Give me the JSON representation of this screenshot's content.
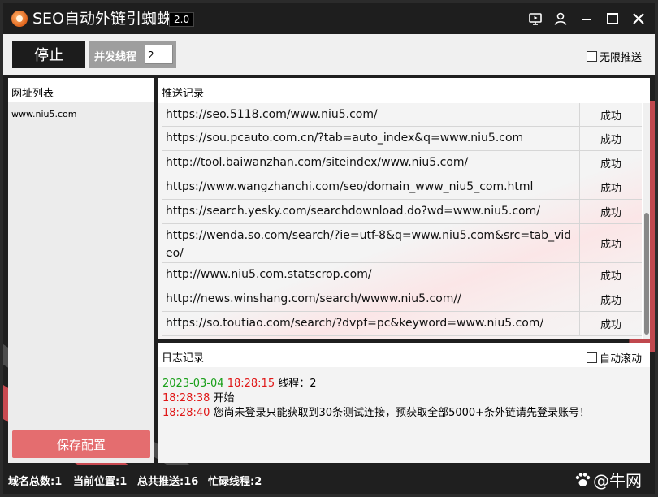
{
  "app": {
    "title": "SEO自动外链引蜘蛛",
    "version": "2.0"
  },
  "toolbar": {
    "stop_label": "停止",
    "concurrency_label": "并发线程",
    "concurrency_value": "2",
    "unlimited_label": "无限推送",
    "unlimited_checked": false
  },
  "url_list": {
    "header": "网址列表",
    "items": [
      "www.niu5.com"
    ],
    "save_label": "保存配置"
  },
  "push_records": {
    "header": "推送记录",
    "rows": [
      {
        "url": "https://seo.5118.com/www.niu5.com/",
        "status": "成功"
      },
      {
        "url": "https://sou.pcauto.com.cn/?tab=auto_index&q=www.niu5.com",
        "status": "成功"
      },
      {
        "url": "http://tool.baiwanzhan.com/siteindex/www.niu5.com/",
        "status": "成功"
      },
      {
        "url": "https://www.wangzhanchi.com/seo/domain_www_niu5_com.html",
        "status": "成功"
      },
      {
        "url": "https://search.yesky.com/searchdownload.do?wd=www.niu5.com/",
        "status": "成功"
      },
      {
        "url": "https://wenda.so.com/search/?ie=utf-8&q=www.niu5.com&src=tab_video/",
        "status": "成功"
      },
      {
        "url": "http://www.niu5.com.statscrop.com/",
        "status": "成功"
      },
      {
        "url": "http://news.winshang.com/search/wwww.niu5.com//",
        "status": "成功"
      },
      {
        "url": "https://so.toutiao.com/search/?dvpf=pc&keyword=www.niu5.com/",
        "status": "成功"
      }
    ]
  },
  "log": {
    "header": "日志记录",
    "autoscroll_label": "自动滚动",
    "autoscroll_checked": false,
    "lines": [
      {
        "date": "2023-03-04",
        "time": "18:28:15",
        "text": "线程：2"
      },
      {
        "time": "18:28:38",
        "text": "开始"
      },
      {
        "time": "18:28:40",
        "text": "您尚未登录只能获取到30条测试连接，预获取全部5000+条外链请先登录账号！"
      }
    ]
  },
  "statusbar": {
    "domains_total": "域名总数:1",
    "current_position": "当前位置:1",
    "total_pushed": "总共推送:16",
    "busy_threads": "忙碌线程:2",
    "watermark": "@牛网"
  },
  "colors": {
    "accent_red": "#e46d6f",
    "success_green": "#1aa01a",
    "time_red": "#e01818",
    "dark": "#1f1f1f"
  }
}
